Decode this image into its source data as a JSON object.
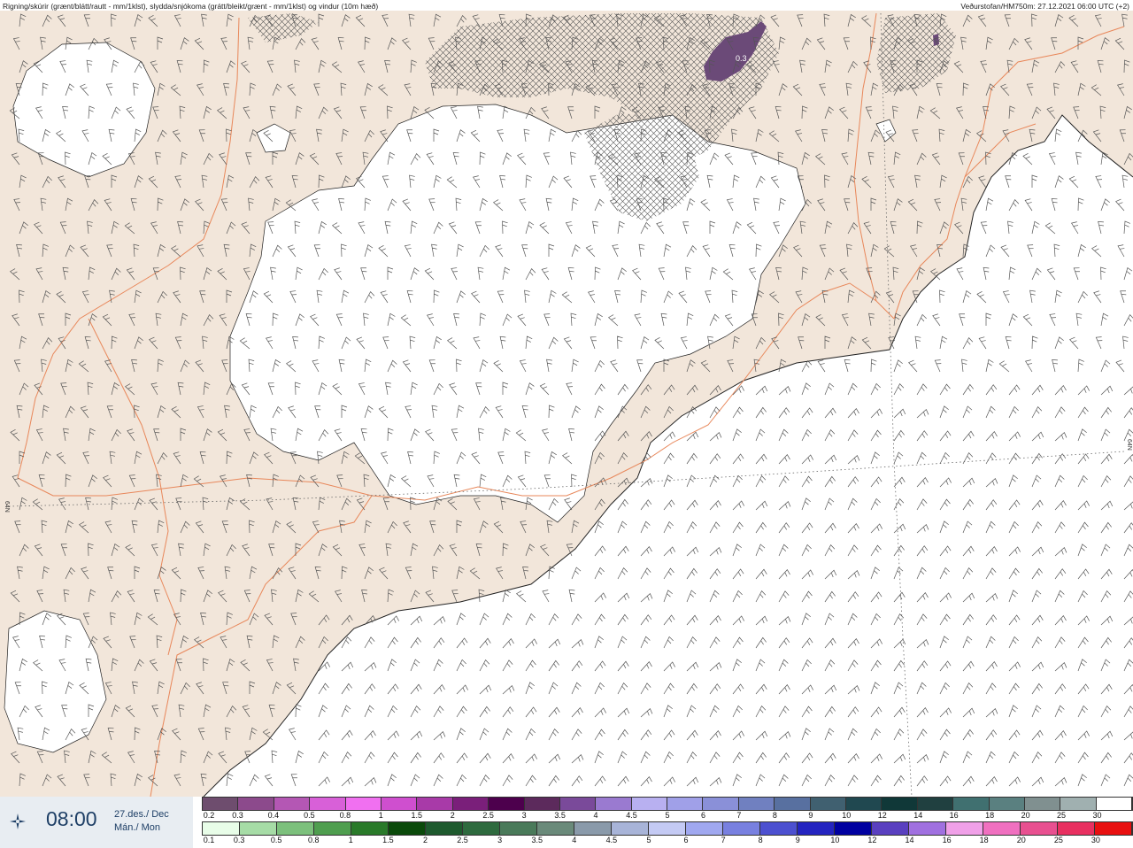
{
  "header": {
    "left": "Rigning/skúrir (grænt/blátt/rautt - mm/1klst), slydda/snjókoma (grátt/bleikt/grænt - mm/1klst) og vindur (10m hæð)",
    "right": "Veðurstofan/HM750m: 27.12.2021 06:00 UTC (+2)"
  },
  "map": {
    "lat_label": "64N",
    "precip_label": "0.3",
    "colors": {
      "land": "#f2e6da",
      "snow": "#ffffff",
      "sea": "#ffffff",
      "border": "#e8875a",
      "precip": "#6b4a78",
      "barb": "#555555",
      "grid": "#666666"
    }
  },
  "footer": {
    "icon": "vedur-logo-icon",
    "time": "08:00",
    "date_line1": "27.des./ Dec",
    "date_line2": "Mán./ Mon"
  },
  "legend_snow": {
    "labels": [
      "0.2",
      "0.3",
      "0.4",
      "0.5",
      "0.8",
      "1",
      "1.5",
      "2",
      "2.5",
      "3",
      "3.5",
      "4",
      "4.5",
      "5",
      "6",
      "7",
      "8",
      "9",
      "10",
      "12",
      "14",
      "16",
      "18",
      "20",
      "25",
      "30"
    ],
    "colors": [
      "#6e4d6e",
      "#8c4a8c",
      "#b457b4",
      "#d860d8",
      "#f070f0",
      "#cf4fcf",
      "#a83aa8",
      "#7a1f7a",
      "#4d004d",
      "#5c2a5c",
      "#7a4a9a",
      "#9a7ad0",
      "#b8b0f0",
      "#a0a0e8",
      "#8a90d8",
      "#7080c0",
      "#5870a0",
      "#406070",
      "#204850",
      "#103838",
      "#204040",
      "#407070",
      "#5a8080",
      "#809090",
      "#a0b0b0",
      "#ffffff"
    ]
  },
  "legend_rain": {
    "labels": [
      "0.1",
      "0.3",
      "0.5",
      "0.8",
      "1",
      "1.5",
      "2",
      "2.5",
      "3",
      "3.5",
      "4",
      "4.5",
      "5",
      "6",
      "7",
      "8",
      "9",
      "10",
      "12",
      "14",
      "16",
      "18",
      "20",
      "25",
      "30"
    ],
    "colors": [
      "#e8fde8",
      "#a6dca6",
      "#7cc07c",
      "#4f9e4f",
      "#2a7a2a",
      "#0a4a0a",
      "#1e5a2e",
      "#2e6a3e",
      "#4a7a5a",
      "#6a8a7a",
      "#8a9aaa",
      "#a8b4d8",
      "#c4caf4",
      "#a0a8f0",
      "#7880e0",
      "#4c50d0",
      "#2424c0",
      "#0000a0",
      "#5a40c0",
      "#a070e0",
      "#f0a0e8",
      "#f070c0",
      "#e85090",
      "#e83060",
      "#e81010"
    ]
  }
}
